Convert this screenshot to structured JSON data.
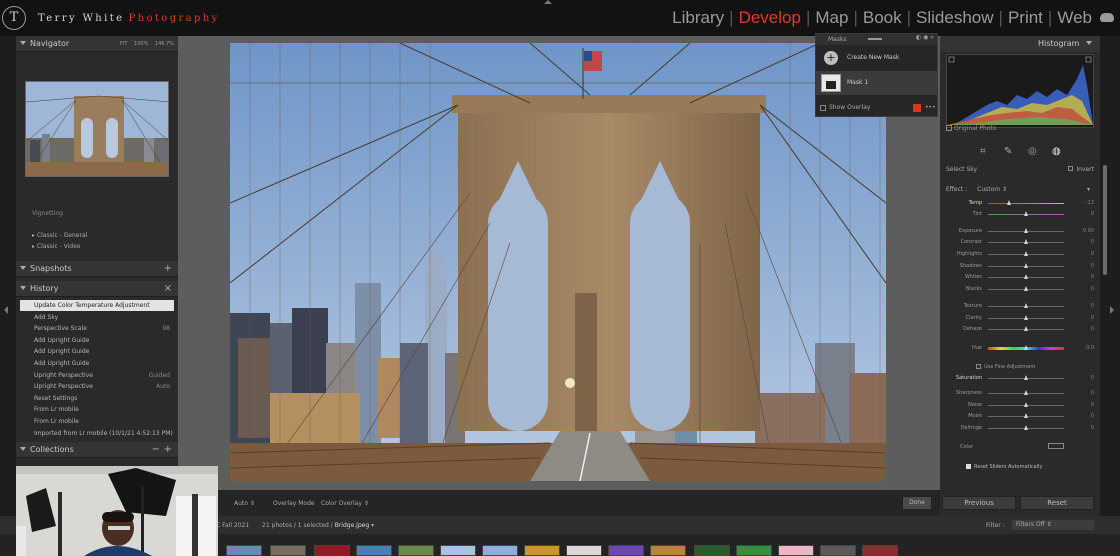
{
  "app": {
    "brand_first": "Terry White",
    "brand_second": "Photography",
    "logo_glyph": "T",
    "modules": [
      {
        "label": "Library",
        "active": false
      },
      {
        "label": "Develop",
        "active": true
      },
      {
        "label": "Map",
        "active": false
      },
      {
        "label": "Book",
        "active": false
      },
      {
        "label": "Slideshow",
        "active": false
      },
      {
        "label": "Print",
        "active": false
      },
      {
        "label": "Web",
        "active": false
      }
    ],
    "module_separator": "|",
    "accent_color": "#e4382a"
  },
  "left": {
    "navigator": {
      "title": "Navigator",
      "zoom_options": [
        "FIT",
        "100%",
        "146.7%"
      ]
    },
    "presets": {
      "truncated_item": "Vignetting",
      "items": [
        "Classic - General",
        "Classic - Video"
      ]
    },
    "snapshots": {
      "title": "Snapshots",
      "add": "+"
    },
    "history": {
      "title": "History",
      "items": [
        {
          "label": "Update Color Temperature Adjustment",
          "value": "",
          "selected": true
        },
        {
          "label": "Add Sky",
          "value": ""
        },
        {
          "label": "Perspective Scale",
          "value": "98"
        },
        {
          "label": "Add Upright Guide",
          "value": ""
        },
        {
          "label": "Add Upright Guide",
          "value": ""
        },
        {
          "label": "Add Upright Guide",
          "value": ""
        },
        {
          "label": "Upright Perspective",
          "value": "Guided"
        },
        {
          "label": "Upright Perspective",
          "value": "Auto"
        },
        {
          "label": "Reset Settings",
          "value": ""
        },
        {
          "label": "From Lr mobile",
          "value": ""
        },
        {
          "label": "From Lr mobile",
          "value": ""
        },
        {
          "label": "Imported from Lr mobile (10/1/21 4:52:13 PM)",
          "value": ""
        }
      ]
    },
    "collections": {
      "title": "Collections",
      "add": "+",
      "minus": "−"
    }
  },
  "mask_panel": {
    "title": "Masks",
    "create_label": "Create New Mask",
    "mask_name": "Mask 1",
    "show_overlay": "Show Overlay",
    "overlay_color": "#e0341d",
    "dots": "•••"
  },
  "toolbar": {
    "auto_label": "Auto",
    "overlay_mode_label": "Overlay Mode",
    "overlay_mode_value": "Color Overlay",
    "done": "Done"
  },
  "right": {
    "histogram_title": "Histogram",
    "original_photo": "Original Photo",
    "select_label": "Select Sky",
    "invert_label": "Invert",
    "effect_label": "Effect :",
    "effect_value": "Custom",
    "sliders": [
      {
        "label": "Temp",
        "value": "-12",
        "pos": 0.28,
        "active": true
      },
      {
        "label": "Tint",
        "value": "0",
        "pos": 0.5
      },
      {
        "label": "Exposure",
        "value": "0.00",
        "pos": 0.5
      },
      {
        "label": "Contrast",
        "value": "0",
        "pos": 0.5
      },
      {
        "label": "Highlights",
        "value": "0",
        "pos": 0.5
      },
      {
        "label": "Shadows",
        "value": "0",
        "pos": 0.5
      },
      {
        "label": "Whites",
        "value": "0",
        "pos": 0.5
      },
      {
        "label": "Blacks",
        "value": "0",
        "pos": 0.5
      },
      {
        "label": "Texture",
        "value": "0",
        "pos": 0.5
      },
      {
        "label": "Clarity",
        "value": "0",
        "pos": 0.5
      },
      {
        "label": "Dehaze",
        "value": "0",
        "pos": 0.5
      },
      {
        "label": "Hue",
        "value": "0.0",
        "pos": 0.5,
        "hue": true
      },
      {
        "label": "Saturation",
        "value": "0",
        "pos": 0.5,
        "active": true
      },
      {
        "label": "Sharpness",
        "value": "0",
        "pos": 0.5
      },
      {
        "label": "Noise",
        "value": "0",
        "pos": 0.5
      },
      {
        "label": "Moiré",
        "value": "0",
        "pos": 0.5
      },
      {
        "label": "Defringe",
        "value": "0",
        "pos": 0.5
      }
    ],
    "fine_adjustment": "Use Fine Adjustment",
    "color_label": "Color",
    "reset_auto": "Reset Sliders Automatically",
    "previous": "Previous",
    "reset": "Reset"
  },
  "filmbar": {
    "collection": "C Fall 2021",
    "count": "21 photos / 1 selected /",
    "filename": "Bridge.jpeg",
    "filter_label": "Filter :",
    "filter_value": "Filters Off"
  }
}
